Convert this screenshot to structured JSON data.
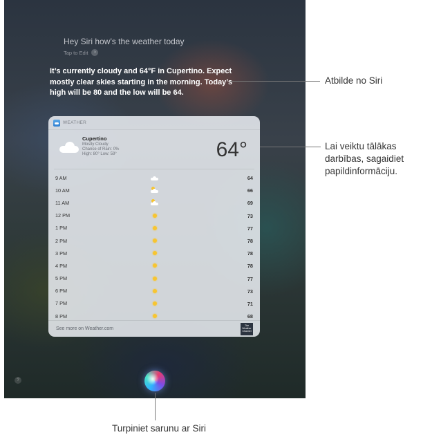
{
  "siri": {
    "query": "Hey Siri how’s the weather today",
    "tap_to_edit": "Tap to Edit",
    "tap_chevron": "›",
    "answer": "It’s currently cloudy and 64°F in Cupertino. Expect mostly clear skies starting in the morning. Today’s high will be 80 and the low will be 64.",
    "help": "?"
  },
  "weather_card": {
    "header": "WEATHER",
    "city": "Cupertino",
    "condition": "Mostly Cloudy",
    "chance_of_rain": "Chance of Rain: 0%",
    "high_low": "High: 80° Low: 59°",
    "current_temp": "64°",
    "hours": [
      {
        "time": "9 AM",
        "icon": "cloud",
        "temp": "64"
      },
      {
        "time": "10 AM",
        "icon": "partly-cloudy",
        "temp": "66"
      },
      {
        "time": "11 AM",
        "icon": "partly-cloudy",
        "temp": "69"
      },
      {
        "time": "12 PM",
        "icon": "sun",
        "temp": "73"
      },
      {
        "time": "1 PM",
        "icon": "sun",
        "temp": "77"
      },
      {
        "time": "2 PM",
        "icon": "sun",
        "temp": "78"
      },
      {
        "time": "3 PM",
        "icon": "sun",
        "temp": "78"
      },
      {
        "time": "4 PM",
        "icon": "sun",
        "temp": "78"
      },
      {
        "time": "5 PM",
        "icon": "sun",
        "temp": "77"
      },
      {
        "time": "6 PM",
        "icon": "sun",
        "temp": "73"
      },
      {
        "time": "7 PM",
        "icon": "sun",
        "temp": "71"
      },
      {
        "time": "8 PM",
        "icon": "sun",
        "temp": "68"
      }
    ],
    "footer_link": "See more on Weather.com",
    "logo_text": "The Weather Channel"
  },
  "callouts": {
    "answer": "Atbilde no Siri",
    "card": "Lai veiktu tālākas darbības, sagaidiet papildinformāciju.",
    "siri_button": "Turpiniet sarunu ar Siri"
  },
  "colors": {
    "sun": "#f7c531",
    "card_bg": "#e8ecf0"
  }
}
